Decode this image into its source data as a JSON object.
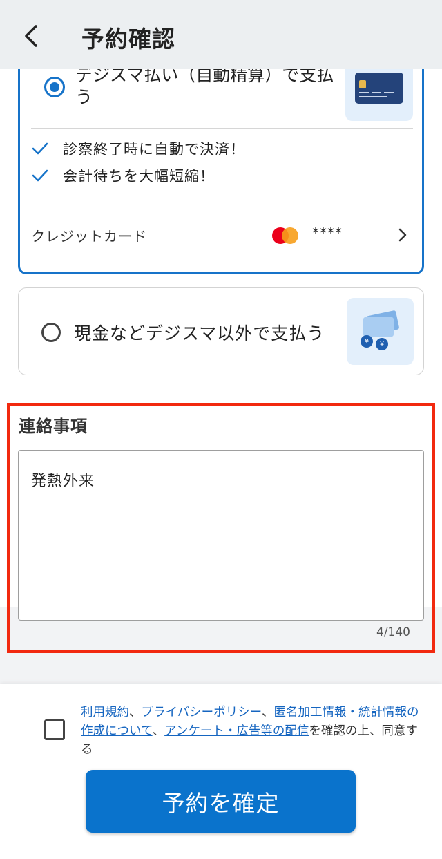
{
  "header": {
    "title": "予約確認"
  },
  "payment": {
    "digisma_option": {
      "label": "デジスマ払い（自動精算）で支払う",
      "selected": true,
      "benefits": [
        "診察終了時に自動で決済！",
        "会計待ちを大幅短縮！"
      ],
      "credit_card": {
        "label": "クレジットカード",
        "brand_icon": "mastercard-logo",
        "masked_number": "****"
      }
    },
    "other_option": {
      "label": "現金などデジスマ以外で支払う",
      "selected": false
    }
  },
  "notes": {
    "title": "連絡事項",
    "value": "発熱外来",
    "char_count": "4/140"
  },
  "footer": {
    "checkbox_checked": false,
    "links": {
      "terms": "利用規約",
      "privacy": "プライバシーポリシー",
      "anon_info": "匿名加工情報・統計情報の作成について",
      "survey": "アンケート・広告等の配信"
    },
    "sep1": "、",
    "sep2": "、",
    "sep3": "、",
    "suffix": "を確認の上、同意する",
    "confirm_button": "予約を確定"
  },
  "colors": {
    "accent": "#1673c9",
    "button": "#0a73cc",
    "highlight": "#f2290f",
    "link": "#1565c0"
  }
}
